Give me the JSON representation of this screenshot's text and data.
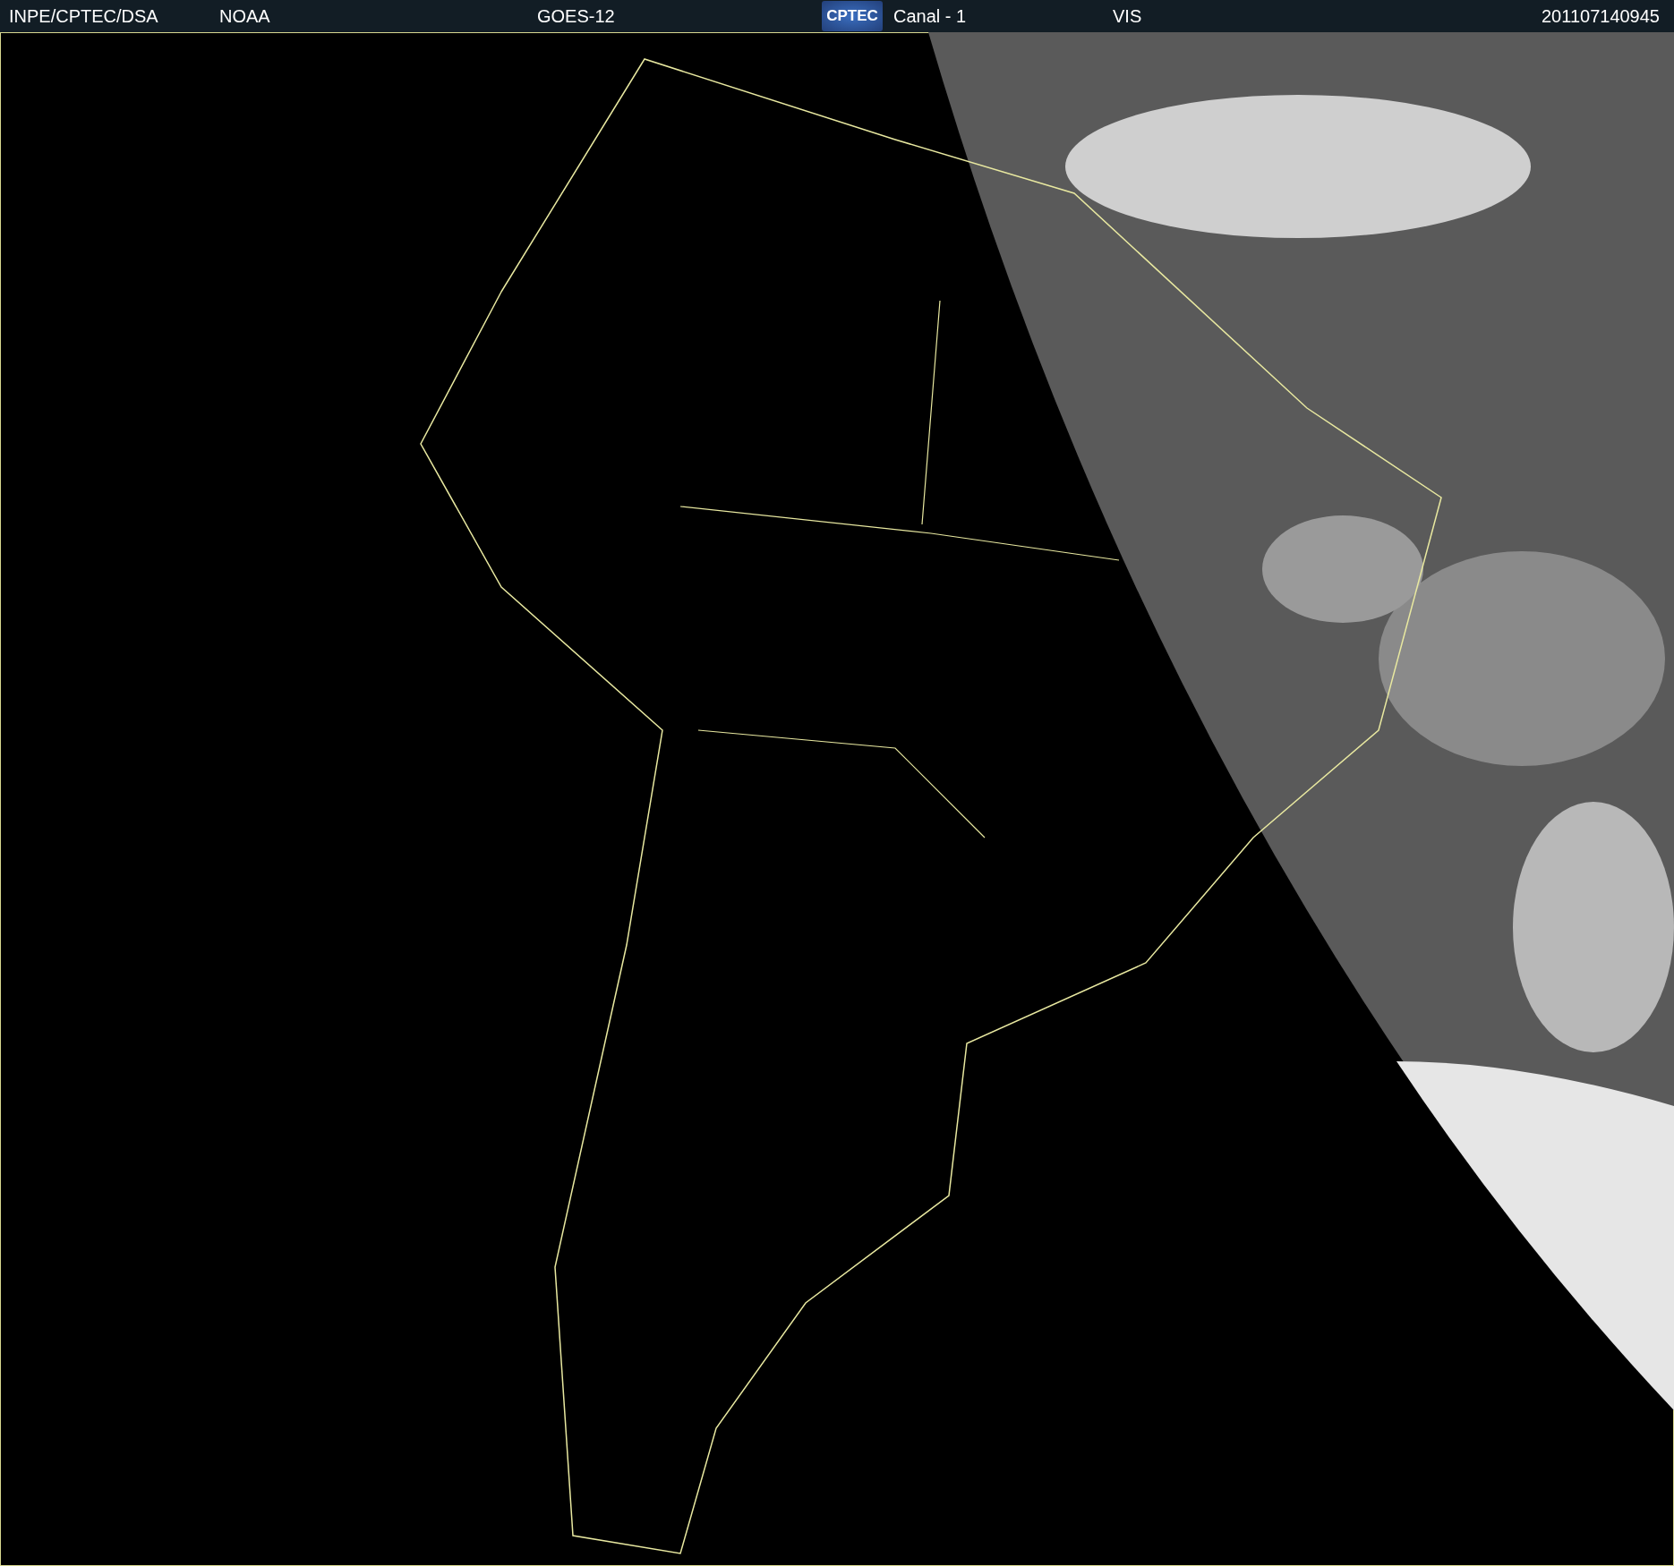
{
  "header": {
    "source": "INPE/CPTEC/DSA",
    "agency": "NOAA",
    "satellite": "GOES-12",
    "logo": "CPTEC",
    "channel": "Canal - 1",
    "band": "VIS",
    "timestamp": "201107140945"
  }
}
